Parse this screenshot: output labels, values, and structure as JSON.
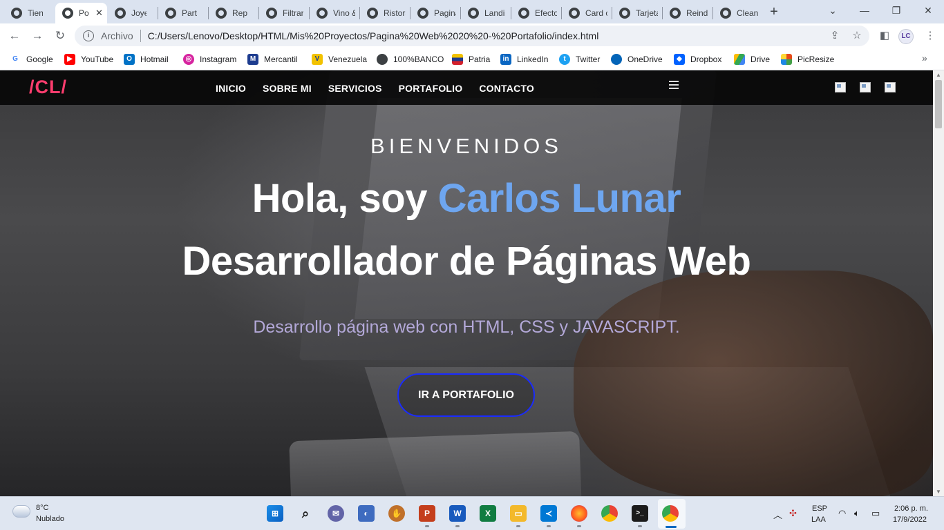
{
  "browser": {
    "tabs": [
      {
        "label": "Tienda",
        "active": false
      },
      {
        "label": "Po",
        "active": true
      },
      {
        "label": "Joyería",
        "active": false
      },
      {
        "label": "Partícl",
        "active": false
      },
      {
        "label": "Repor",
        "active": false
      },
      {
        "label": "Filtrar",
        "active": false
      },
      {
        "label": "Vino &",
        "active": false
      },
      {
        "label": "Ristora",
        "active": false
      },
      {
        "label": "Pagina",
        "active": false
      },
      {
        "label": "Landi",
        "active": false
      },
      {
        "label": "Efecto",
        "active": false
      },
      {
        "label": "Card c",
        "active": false
      },
      {
        "label": "Tarjeta",
        "active": false
      },
      {
        "label": "Reind",
        "active": false
      },
      {
        "label": "Clean",
        "active": false
      }
    ],
    "address": {
      "scheme_label": "Archivo",
      "url": "C:/Users/Lenovo/Desktop/HTML/Mis%20Proyectos/Pagina%20Web%2020%20-%20Portafolio/index.html"
    },
    "profile_initials": "LC",
    "bookmarks": [
      {
        "label": "Google",
        "icon": "google-icon",
        "color": "#4285f4"
      },
      {
        "label": "YouTube",
        "icon": "youtube-icon",
        "color": "#ff0000"
      },
      {
        "label": "Hotmail",
        "icon": "outlook-icon",
        "color": "#0072c6"
      },
      {
        "label": "Instagram",
        "icon": "instagram-icon",
        "color": "#d6249f"
      },
      {
        "label": "Mercantil",
        "icon": "mercantil-icon",
        "color": "#1d3c8f"
      },
      {
        "label": "Venezuela",
        "icon": "venezuela-icon",
        "color": "#f2c200"
      },
      {
        "label": "100%BANCO",
        "icon": "globe-icon",
        "color": "#3c4043"
      },
      {
        "label": "Patria",
        "icon": "patria-icon",
        "color": "#d3212c"
      },
      {
        "label": "LinkedIn",
        "icon": "linkedin-icon",
        "color": "#0a66c2"
      },
      {
        "label": "Twitter",
        "icon": "twitter-icon",
        "color": "#1da1f2"
      },
      {
        "label": "OneDrive",
        "icon": "onedrive-icon",
        "color": "#0364b8"
      },
      {
        "label": "Dropbox",
        "icon": "dropbox-icon",
        "color": "#0061ff"
      },
      {
        "label": "Drive",
        "icon": "drive-icon",
        "color": "#34a853"
      },
      {
        "label": "PicResize",
        "icon": "picresize-icon",
        "color": "#e64a19"
      }
    ]
  },
  "site": {
    "logo": "/CL/",
    "menu": [
      "INICIO",
      "SOBRE MI",
      "SERVICIOS",
      "PORTAFOLIO",
      "CONTACTO"
    ],
    "hero": {
      "kicker": "BIENVENIDOS",
      "greeting": "Hola, soy",
      "name": "Carlos Lunar",
      "role": "Desarrollador de Páginas Web",
      "description": "Desarrollo página web con HTML, CSS y JAVASCRIPT.",
      "cta": "IR A PORTAFOLIO"
    },
    "colors": {
      "logo": "#ff3d6e",
      "name": "#6ea6f0",
      "cta_border": "#1a2bff",
      "description": "#b3a8d8"
    }
  },
  "taskbar": {
    "weather": {
      "temp": "8°C",
      "desc": "Nublado"
    },
    "apps": [
      "windows-start-icon",
      "search-icon",
      "chat-icon",
      "photos-icon",
      "baseball-glove-icon",
      "powerpoint-icon",
      "word-icon",
      "excel-icon",
      "file-explorer-icon",
      "vscode-icon",
      "firefox-icon",
      "chrome-icon",
      "terminal-icon",
      "chrome-profile-icon"
    ],
    "language": {
      "line1": "ESP",
      "line2": "LAA"
    },
    "clock": {
      "time": "2:06 p. m.",
      "date": "17/9/2022"
    }
  }
}
